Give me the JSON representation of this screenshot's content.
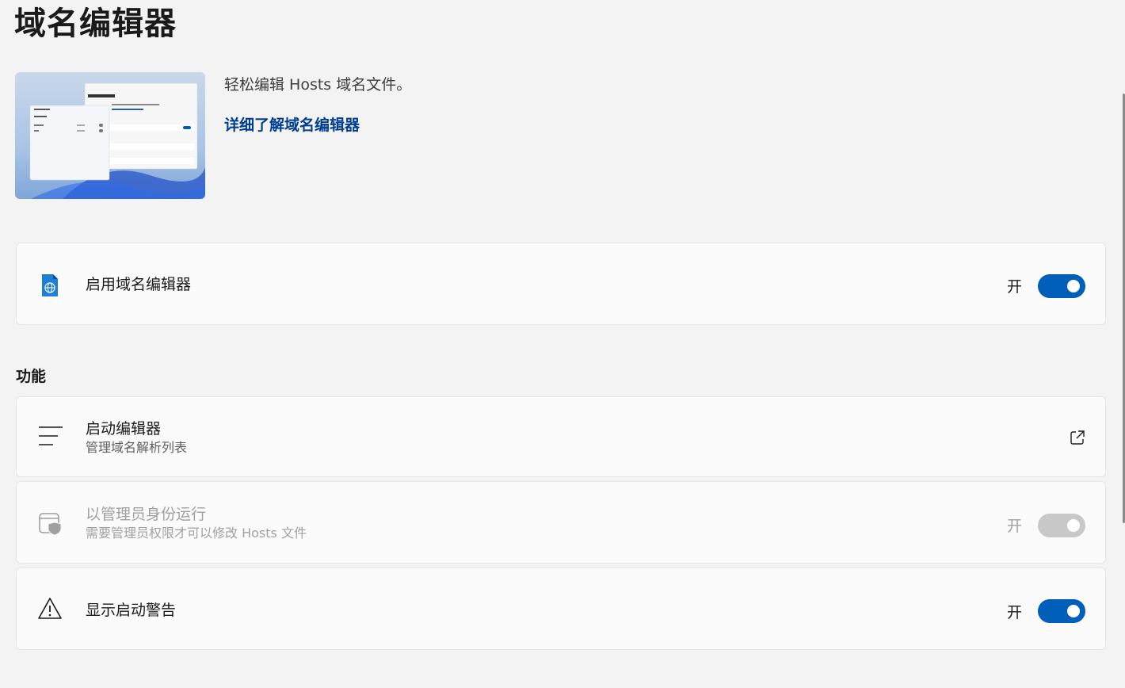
{
  "page": {
    "title": "域名编辑器"
  },
  "hero": {
    "description": "轻松编辑 Hosts 域名文件。",
    "link_label": "详细了解域名编辑器",
    "image_icon": "hosts-editor-preview-image"
  },
  "enable_card": {
    "title": "启用域名编辑器",
    "icon": "hosts-file-icon",
    "toggle_label": "开",
    "toggle_on": true
  },
  "section": {
    "features_label": "功能"
  },
  "launch_card": {
    "title": "启动编辑器",
    "subtitle": "管理域名解析列表",
    "icon": "list-icon",
    "action_icon": "open-external-icon"
  },
  "admin_card": {
    "title": "以管理员身份运行",
    "subtitle": "需要管理员权限才可以修改 Hosts 文件",
    "icon": "shield-window-icon",
    "toggle_label": "开",
    "toggle_on": true,
    "disabled": true
  },
  "warning_card": {
    "title": "显示启动警告",
    "icon": "warning-icon",
    "toggle_label": "开",
    "toggle_on": true
  },
  "colors": {
    "accent": "#005fb8",
    "link": "#003e92",
    "background": "#f3f3f3",
    "card": "#fbfbfb"
  }
}
